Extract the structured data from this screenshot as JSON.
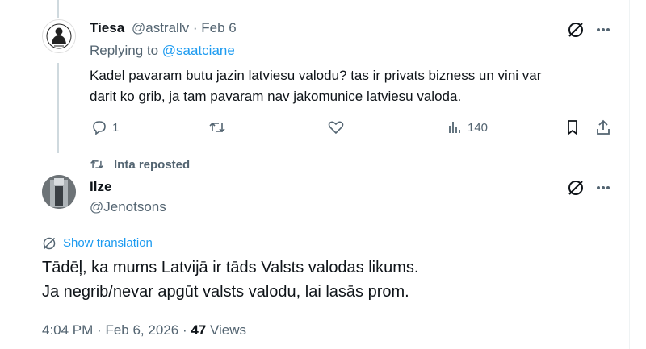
{
  "tweet1": {
    "name": "Tiesa",
    "handle": "@astrallv",
    "sep": "·",
    "date": "Feb 6",
    "replying_prefix": "Replying to",
    "replying_handle": "@saatciane",
    "text_line1": "Kadel pavaram butu jazin latviesu valodu? tas ir privats bizness un vini var",
    "text_line2": "darit ko grib, ja tam pavaram nav jakomunice latviesu valoda.",
    "reply_count": "1",
    "views_count": "140"
  },
  "repost_label": "Inta reposted",
  "tweet2": {
    "name": "Ilze",
    "handle": "@Jenotsons",
    "translate_label": "Show translation",
    "text_line1": "Tādēļ, ka mums Latvijā ir tāds Valsts valodas likums.",
    "text_line2": "Ja negrib/nevar apgūt valsts valodu, lai lasās prom.",
    "time": "4:04 PM",
    "sep": "·",
    "date": "Feb 6, 2026",
    "views_num": "47",
    "views_label": "Views"
  },
  "colors": {
    "accent": "#1d9bf0",
    "muted": "#536471",
    "text": "#0f1419"
  }
}
